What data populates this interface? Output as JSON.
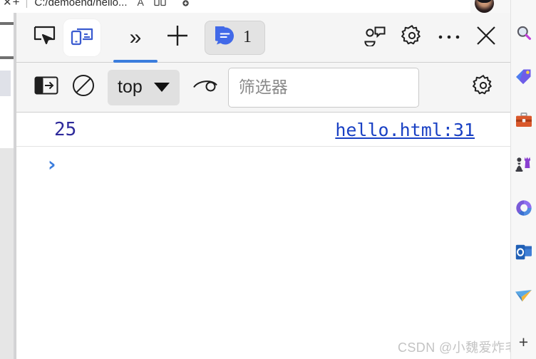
{
  "browser": {
    "tab_close_glyph": "✕",
    "new_tab_glyph": "+",
    "separator": "|",
    "address_text": "C:/demoend/hello...",
    "addr_icon_a": "A",
    "addr_icon_b": "split-screen",
    "addr_icon_c": "add-collection",
    "avatar_name": "profile-avatar"
  },
  "devtools": {
    "toolbar": {
      "inspect_tooltip": "Inspect element",
      "device_toolbar_tooltip": "Toggle device toolbar",
      "more_panels_glyph": "»",
      "add_panel_glyph": "+",
      "message_count": "1",
      "feedback_tooltip": "Send feedback",
      "settings_tooltip": "Settings",
      "more_options_glyph": "⋯",
      "close_glyph": "✕"
    },
    "console_toolbar": {
      "sidebar_toggle_tooltip": "Show console sidebar",
      "clear_console_tooltip": "Clear console",
      "context_selected": "top",
      "context_dropdown_glyph": "▼",
      "live_expression_tooltip": "Create live expression",
      "filter_placeholder": "筛选器",
      "filter_value": "",
      "console_settings_tooltip": "Console settings"
    },
    "console": {
      "entries": [
        {
          "value": "25",
          "source": "hello.html:31"
        }
      ],
      "prompt_glyph": "›"
    }
  },
  "sidebar": {
    "items": [
      {
        "name": "search-icon",
        "label": "Search"
      },
      {
        "name": "tag-icon",
        "label": "Shopping"
      },
      {
        "name": "briefcase-icon",
        "label": "Tools"
      },
      {
        "name": "chess-icon",
        "label": "Games"
      },
      {
        "name": "office-icon",
        "label": "Microsoft 365"
      },
      {
        "name": "outlook-icon",
        "label": "Outlook"
      },
      {
        "name": "paperplane-icon",
        "label": "Drop"
      }
    ],
    "add_label": "+"
  },
  "watermark": {
    "text": "CSDN @小魏爱炸毛"
  },
  "colors": {
    "accent_blue": "#3b7ddd",
    "link_blue": "#1a41c4",
    "value_blue": "#2e2a9b",
    "toolbar_bg": "#f5f5f5"
  }
}
